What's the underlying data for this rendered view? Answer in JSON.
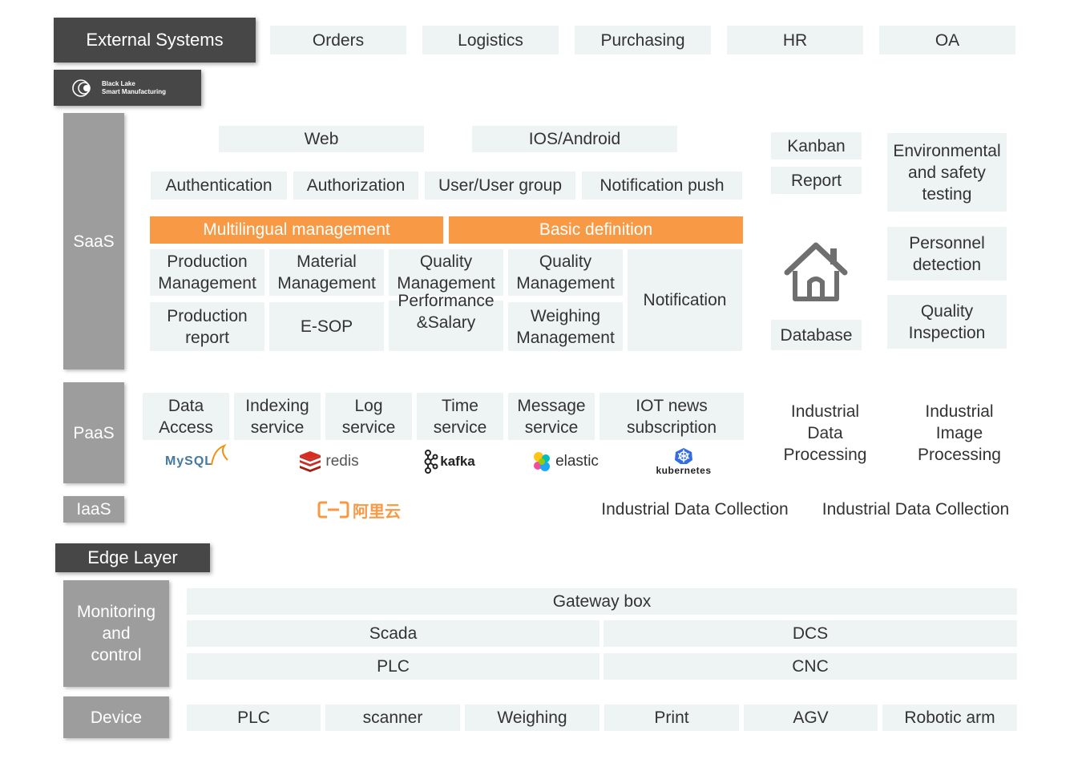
{
  "external": {
    "label": "External Systems",
    "items": [
      "Orders",
      "Logistics",
      "Purchasing",
      "HR",
      "OA"
    ]
  },
  "brand": {
    "line1": "Black Lake",
    "line2": "Smart Manufacturing"
  },
  "saas": {
    "label": "SaaS",
    "clients": [
      "Web",
      "IOS/Android"
    ],
    "services": [
      "Authentication",
      "Authorization",
      "User/User group",
      "Notification push"
    ],
    "bars": [
      "Multilingual management",
      "Basic definition"
    ],
    "modules": {
      "production_management": "Production\nManagement",
      "material_management": "Material\nManagement",
      "quality_management_1": "Quality\nManagement",
      "quality_management_2": "Quality\nManagement",
      "notification": "Notification",
      "production_report": "Production\nreport",
      "esop": "E-SOP",
      "performance_salary": "Performance\n&Salary",
      "weighing_management": "Weighing\nManagement"
    },
    "kanban": "Kanban",
    "report": "Report",
    "database": "Database",
    "environmental": "Environmental\nand safety\ntesting",
    "personnel": "Personnel\ndetection",
    "quality_inspection": "Quality\nInspection"
  },
  "paas": {
    "label": "PaaS",
    "services": [
      "Data\nAccess",
      "Indexing\nservice",
      "Log\nservice",
      "Time\nservice",
      "Message\nservice",
      "IOT news\nsubscription"
    ],
    "logos": [
      "MySQL",
      "redis",
      "kafka",
      "elastic",
      "kubernetes"
    ],
    "industrial_data": "Industrial\nData\nProcessing",
    "industrial_image": "Industrial\nImage\nProcessing"
  },
  "iaas": {
    "label": "IaaS",
    "cloud": "阿里云",
    "collection_1": "Industrial Data Collection",
    "collection_2": "Industrial Data Collection"
  },
  "edge": {
    "label": "Edge Layer",
    "monitoring": "Monitoring\nand\ncontrol",
    "gateway": "Gateway box",
    "scada": "Scada",
    "dcs": "DCS",
    "plc": "PLC",
    "cnc": "CNC",
    "device_label": "Device",
    "devices": [
      "PLC",
      "scanner",
      "Weighing",
      "Print",
      "AGV",
      "Robotic arm"
    ]
  },
  "colors": {
    "accent": "#f89a45",
    "dark": "#474747",
    "label_gray": "#9d9d9d",
    "cell": "#eef3f3",
    "aliyun": "#f89a45"
  }
}
